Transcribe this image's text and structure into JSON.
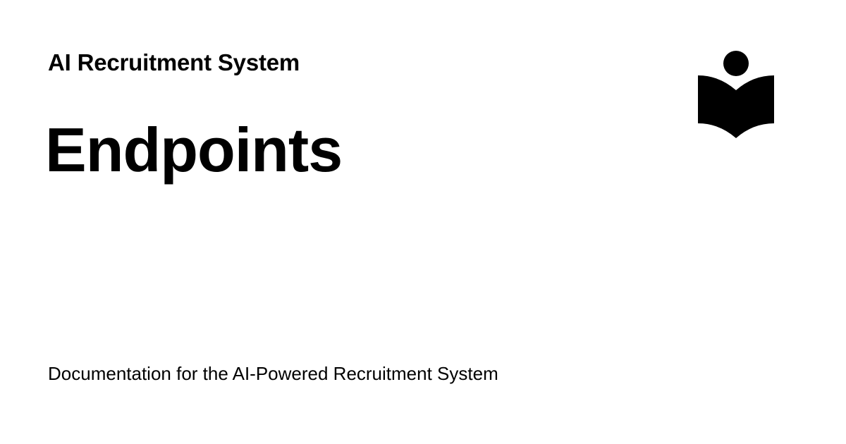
{
  "header": {
    "site_name": "AI Recruitment System",
    "logo_icon": "reader-book-icon"
  },
  "main": {
    "page_title": "Endpoints",
    "description": "Documentation for the AI-Powered Recruitment System"
  },
  "colors": {
    "background": "#ffffff",
    "text": "#000000",
    "icon": "#000000"
  }
}
